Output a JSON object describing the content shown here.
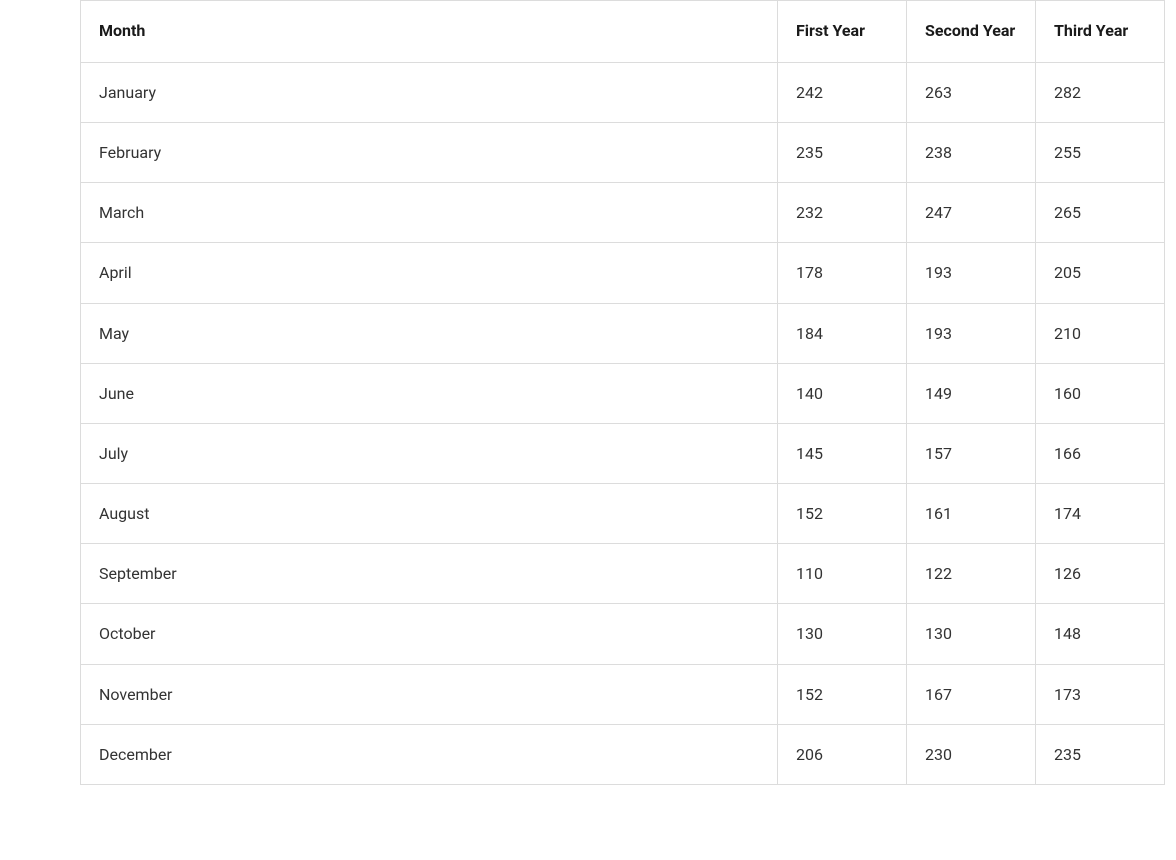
{
  "chart_data": {
    "type": "table",
    "columns": [
      "Month",
      "First Year",
      "Second Year",
      "Third Year"
    ],
    "rows": [
      [
        "January",
        242,
        263,
        282
      ],
      [
        "February",
        235,
        238,
        255
      ],
      [
        "March",
        232,
        247,
        265
      ],
      [
        "April",
        178,
        193,
        205
      ],
      [
        "May",
        184,
        193,
        210
      ],
      [
        "June",
        140,
        149,
        160
      ],
      [
        "July",
        145,
        157,
        166
      ],
      [
        "August",
        152,
        161,
        174
      ],
      [
        "September",
        110,
        122,
        126
      ],
      [
        "October",
        130,
        130,
        148
      ],
      [
        "November",
        152,
        167,
        173
      ],
      [
        "December",
        206,
        230,
        235
      ]
    ]
  },
  "headers": {
    "month": "Month",
    "first": "First Year",
    "second": "Second Year",
    "third": "Third Year"
  },
  "rows": [
    {
      "month": "January",
      "first": "242",
      "second": "263",
      "third": "282"
    },
    {
      "month": "February",
      "first": "235",
      "second": "238",
      "third": "255"
    },
    {
      "month": "March",
      "first": "232",
      "second": "247",
      "third": "265"
    },
    {
      "month": "April",
      "first": "178",
      "second": "193",
      "third": "205"
    },
    {
      "month": "May",
      "first": "184",
      "second": "193",
      "third": "210"
    },
    {
      "month": "June",
      "first": "140",
      "second": "149",
      "third": "160"
    },
    {
      "month": "July",
      "first": "145",
      "second": "157",
      "third": "166"
    },
    {
      "month": "August",
      "first": "152",
      "second": "161",
      "third": "174"
    },
    {
      "month": "September",
      "first": "110",
      "second": "122",
      "third": "126"
    },
    {
      "month": "October",
      "first": "130",
      "second": "130",
      "third": "148"
    },
    {
      "month": "November",
      "first": "152",
      "second": "167",
      "third": "173"
    },
    {
      "month": "December",
      "first": "206",
      "second": "230",
      "third": "235"
    }
  ]
}
